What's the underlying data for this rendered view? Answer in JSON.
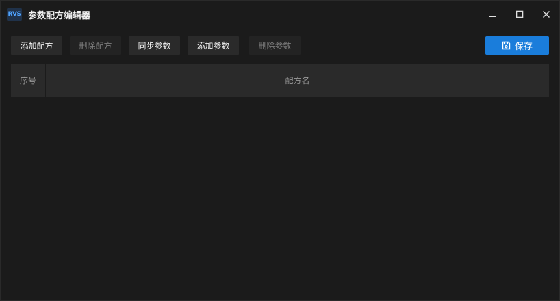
{
  "window": {
    "title": "参数配方编辑器",
    "logo_text": "RVS"
  },
  "toolbar": {
    "add_recipe": "添加配方",
    "delete_recipe": "删除配方",
    "sync_params": "同步参数",
    "add_param": "添加参数",
    "delete_param": "删除参数",
    "save": "保存"
  },
  "table": {
    "columns": [
      "序号",
      "配方名"
    ],
    "rows": []
  },
  "colors": {
    "background": "#1b1b1b",
    "button": "#2a2a2a",
    "accent": "#1a7ddb"
  }
}
